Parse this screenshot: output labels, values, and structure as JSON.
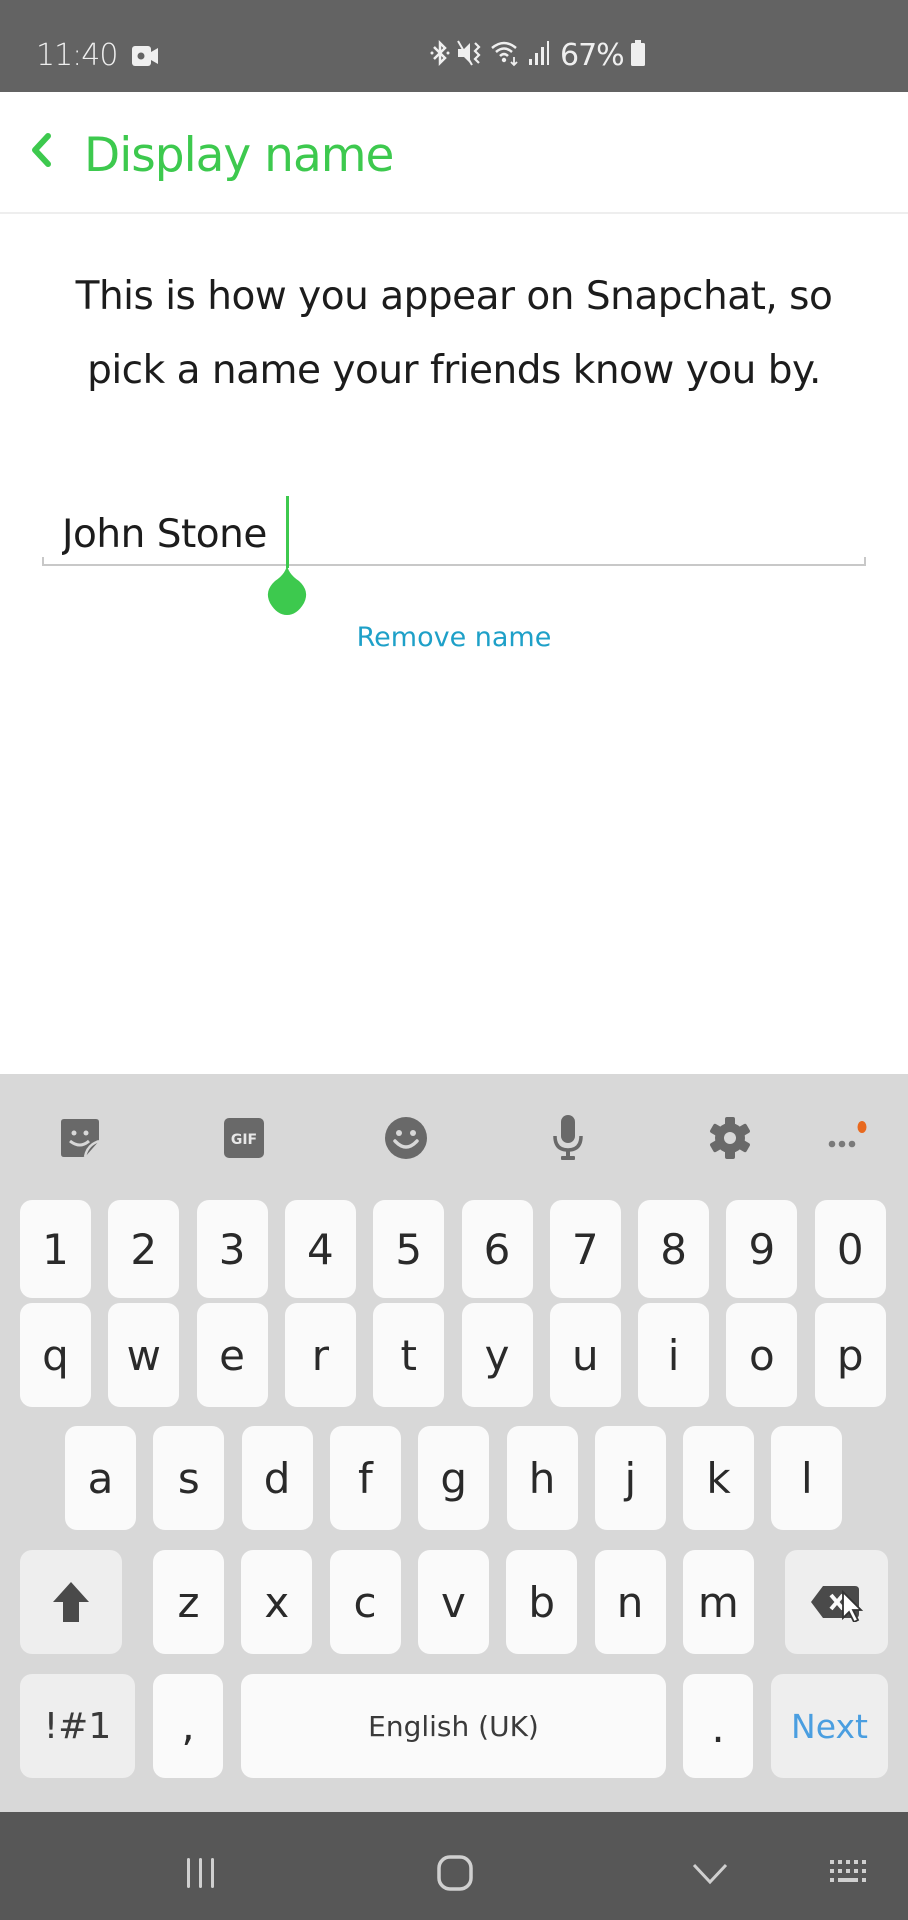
{
  "status_bar": {
    "time": "11:40",
    "battery_percent": "67%",
    "icons": [
      "screen-record-icon",
      "bluetooth-icon",
      "vibrate-icon",
      "wifi-icon",
      "signal-icon",
      "battery-icon"
    ]
  },
  "header": {
    "back_icon": "chevron-left-icon",
    "title": "Display name"
  },
  "content": {
    "description_line1": "This is how you appear on Snapchat, so",
    "description_line2": "pick a name your friends know you by.",
    "name_field_value": "John Stone",
    "remove_name_label": "Remove name"
  },
  "colors": {
    "accent_green": "#3dc94e",
    "link_blue": "#1ea0c8",
    "next_blue": "#4a9ee0",
    "notification_dot": "#e8691e"
  },
  "keyboard": {
    "toolbar": [
      {
        "name": "sticker-icon"
      },
      {
        "name": "gif-icon",
        "label": "GIF"
      },
      {
        "name": "emoji-icon"
      },
      {
        "name": "microphone-icon"
      },
      {
        "name": "settings-gear-icon"
      },
      {
        "name": "more-options-icon"
      }
    ],
    "row_numbers": [
      "1",
      "2",
      "3",
      "4",
      "5",
      "6",
      "7",
      "8",
      "9",
      "0"
    ],
    "row_top": [
      "q",
      "w",
      "e",
      "r",
      "t",
      "y",
      "u",
      "i",
      "o",
      "p"
    ],
    "row_middle": [
      "a",
      "s",
      "d",
      "f",
      "g",
      "h",
      "j",
      "k",
      "l"
    ],
    "row_bottom": [
      "z",
      "x",
      "c",
      "v",
      "b",
      "n",
      "m"
    ],
    "shift_icon": "shift-arrow-icon",
    "backspace_icon": "backspace-icon",
    "symbols_label": "!#1",
    "comma_label": ",",
    "space_label": "English (UK)",
    "period_label": ".",
    "next_label": "Next"
  },
  "nav_bar": {
    "icons": [
      "recent-apps-icon",
      "home-icon",
      "hide-keyboard-icon",
      "keyboard-switch-icon"
    ]
  }
}
